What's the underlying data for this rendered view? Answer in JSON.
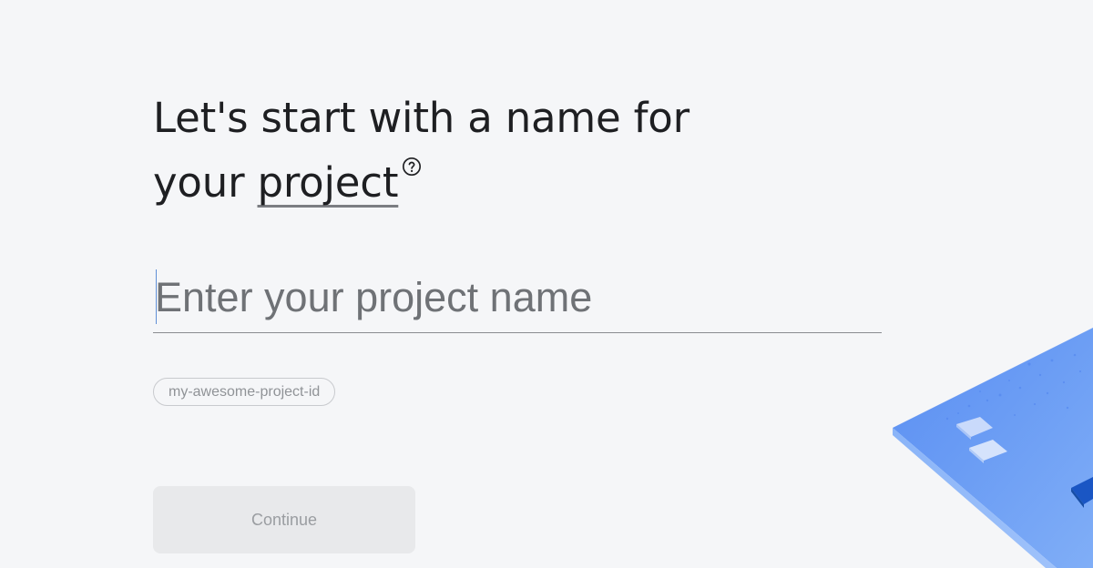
{
  "heading": {
    "line1": "Let's start with a name for",
    "line2_prefix": "your ",
    "line2_term": "project"
  },
  "icons": {
    "help": "help-circle-icon"
  },
  "name_input": {
    "value": "",
    "placeholder": "Enter your project name"
  },
  "project_id_chip": {
    "label": "my-awesome-project-id"
  },
  "continue_button": {
    "label": "Continue",
    "state": "disabled"
  },
  "colors": {
    "background": "#f5f6f8",
    "heading_text": "#1e1f22",
    "placeholder_text": "#6f7276",
    "accent_blue": "#4285f4",
    "button_disabled_bg": "#e8e9eb",
    "button_disabled_text": "#9a9da1"
  }
}
